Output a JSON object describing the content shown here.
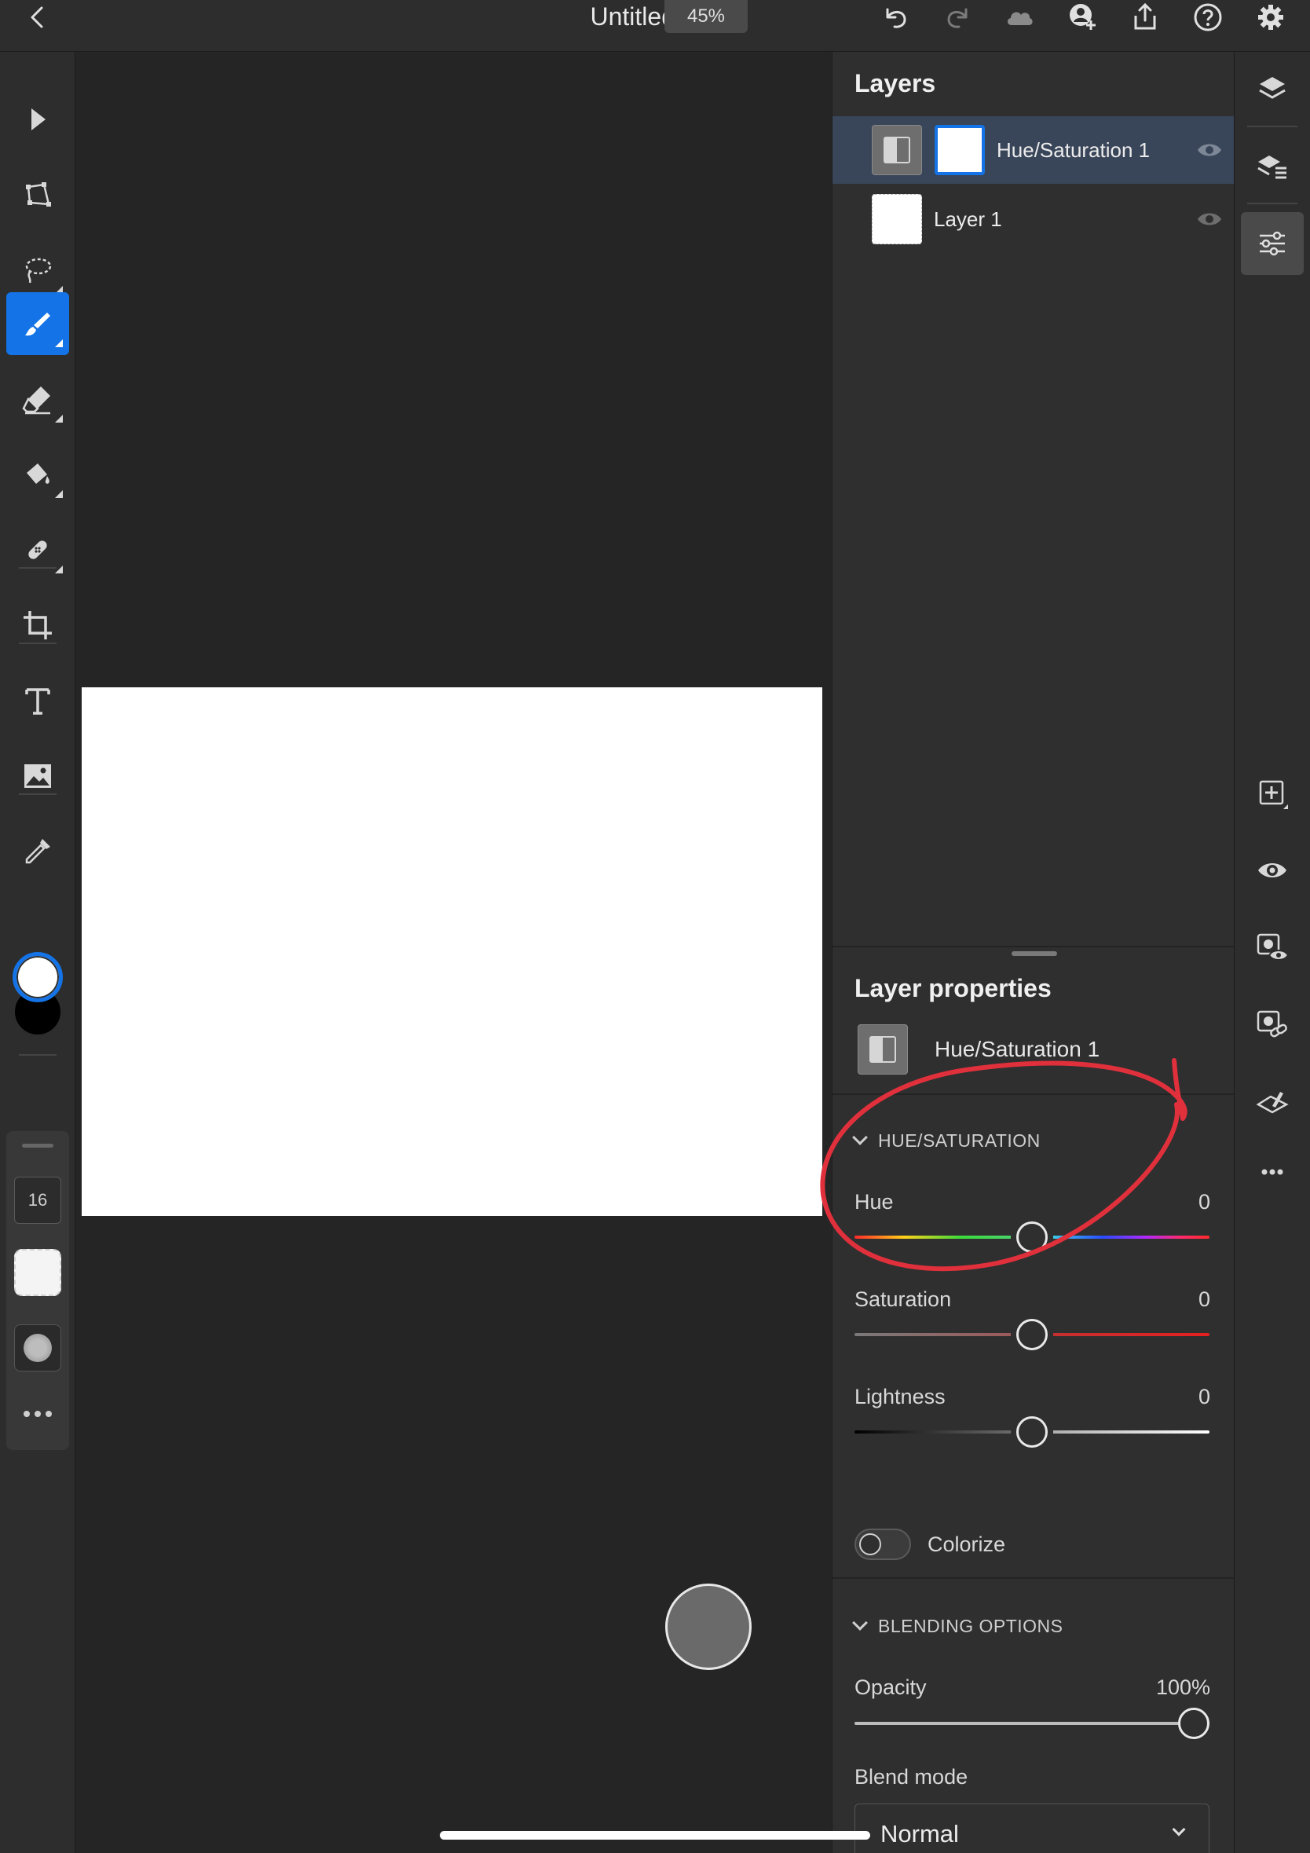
{
  "app": {
    "title": "Untitled",
    "zoom": "45%"
  },
  "topbar": {
    "icons": [
      "back-icon",
      "undo-icon",
      "redo-icon",
      "cloud-icon",
      "invite-icon",
      "share-icon",
      "help-icon",
      "settings-icon"
    ]
  },
  "toolbar": {
    "tools": [
      "select-icon",
      "transform-icon",
      "lasso-icon",
      "brush-icon",
      "eraser-icon",
      "paint-bucket-icon",
      "healing-icon",
      "crop-icon",
      "type-icon",
      "place-image-icon",
      "eyedropper-icon",
      "swap-colors-icon"
    ],
    "active_tool": "brush-icon",
    "foreground_color": "#ffffff",
    "background_color": "#000000",
    "brush_size": "16"
  },
  "layers": {
    "title": "Layers",
    "items": [
      {
        "name": "Hue/Saturation 1",
        "selected": true,
        "type": "adjustment"
      },
      {
        "name": "Layer 1",
        "selected": false,
        "type": "pixel"
      }
    ]
  },
  "properties": {
    "title": "Layer properties",
    "layer_name": "Hue/Saturation 1",
    "hue_sat": {
      "section": "HUE/SATURATION",
      "hue": {
        "label": "Hue",
        "value": "0"
      },
      "saturation": {
        "label": "Saturation",
        "value": "0"
      },
      "lightness": {
        "label": "Lightness",
        "value": "0"
      },
      "colorize": {
        "label": "Colorize",
        "on": false
      }
    },
    "blending": {
      "section": "BLENDING OPTIONS",
      "opacity": {
        "label": "Opacity",
        "value": "100%",
        "fraction": 1.0
      },
      "blend_mode": {
        "label": "Blend mode",
        "value": "Normal"
      }
    }
  },
  "rail": {
    "icons": [
      "layers-icon",
      "layer-stack-icon",
      "adjustments-icon",
      "add-layer-icon",
      "visibility-icon",
      "mask-visibility-icon",
      "link-icon",
      "clear-icon",
      "more-icon"
    ],
    "active": "adjustments-icon"
  },
  "colors": {
    "accent": "#1473e6",
    "selected_row": "#394559",
    "annotation": "#e0303c"
  }
}
